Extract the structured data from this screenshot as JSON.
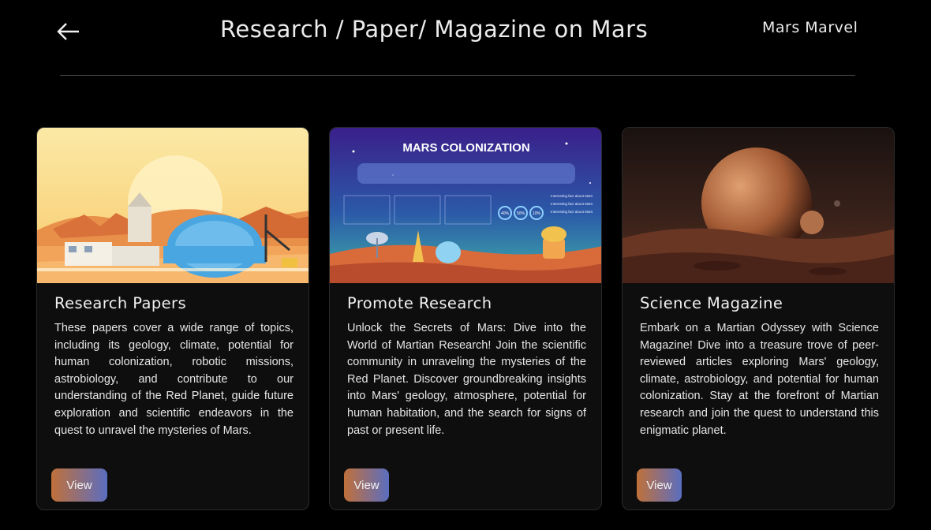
{
  "header": {
    "title": "Research / Paper/ Magazine on Mars",
    "brand": "Mars Marvel",
    "back_icon": "arrow-left-icon"
  },
  "cards": [
    {
      "title": "Research Papers",
      "description": "These papers cover a wide range of topics, including its geology, climate, potential for human colonization, robotic missions, astrobiology, and contribute to our understanding of the Red Planet, guide future exploration and scientific endeavors in the quest to unravel the mysteries of Mars.",
      "button": "View"
    },
    {
      "title": "Promote Research",
      "description": "Unlock the Secrets of Mars: Dive into the World of Martian Research! Join the scientific community in unraveling the mysteries of the Red Planet. Discover groundbreaking insights into Mars' geology, atmosphere, potential for human habitation, and the search for signs of past or present life.",
      "button": "View",
      "image_text": {
        "heading": "MARS COLONIZATION",
        "stat1": "40%",
        "stat2": "50%",
        "stat3": "10%",
        "fact": "Interesting fact about Mars"
      }
    },
    {
      "title": "Science Magazine",
      "description": "Embark on a Martian Odyssey with Science Magazine! Dive into a treasure trove of peer-reviewed articles exploring Mars' geology, climate, astrobiology, and potential for human colonization. Stay at the forefront of Martian research and join the quest to understand this enigmatic planet.",
      "button": "View"
    }
  ],
  "colors": {
    "background": "#000000",
    "card": "#0e0e0e",
    "button_gradient_start": "#c0703a",
    "button_gradient_end": "#5a6ec0"
  }
}
